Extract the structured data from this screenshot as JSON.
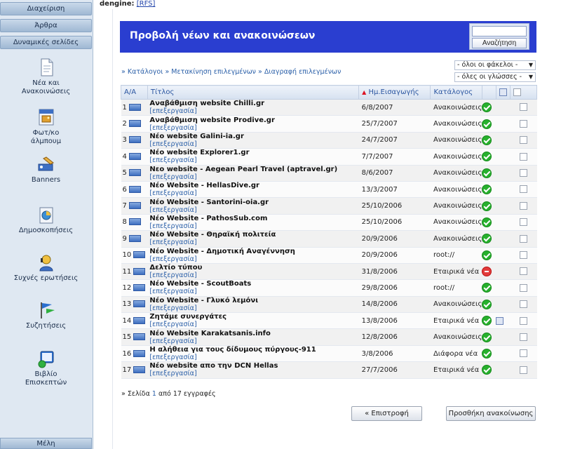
{
  "topline": {
    "label": "dengine:",
    "link": "[RFS]"
  },
  "sidebar": {
    "tabs": [
      "Διαχείριση",
      "Άρθρα",
      "Δυναμικές σελίδες"
    ],
    "items": [
      {
        "label1": "Νέα και",
        "label2": "Ανακοινώσεις",
        "icon": "news-document-icon"
      },
      {
        "label1": "Φωτ/κο",
        "label2": "άλμπουμ",
        "icon": "photo-album-icon"
      },
      {
        "label1": "Banners",
        "label2": "",
        "icon": "banners-icon"
      },
      {
        "label1": "Δημοσκοπήσεις",
        "label2": "",
        "icon": "polls-icon"
      },
      {
        "label1": "Συχνές ερωτήσεις",
        "label2": "",
        "icon": "faq-icon"
      },
      {
        "label1": "Συζητήσεις",
        "label2": "",
        "icon": "discussions-icon"
      },
      {
        "label1": "Βιβλίο",
        "label2": "Επισκεπτών",
        "icon": "guestbook-icon"
      }
    ],
    "bottom": "Μέλη"
  },
  "header": {
    "title": "Προβολή νέων και ανακοινώσεων",
    "search_button": "Αναζήτηση",
    "search_value": ""
  },
  "breadcrumb": {
    "items": [
      "Κατάλογοι",
      "Μετακίνηση επιλεγμένων",
      "Διαγραφή επιλεγμένων"
    ],
    "sep": "»"
  },
  "filters": {
    "folders": "- όλοι οι φάκελοι -",
    "languages": "- όλες οι γλώσσες -"
  },
  "table": {
    "headers": {
      "num": "Α/Α",
      "title": "Τίτλος",
      "date": "Ημ.Εισαγωγής",
      "category": "Κατάλογος"
    },
    "edit_label": "[επεξεργασία]",
    "rows": [
      {
        "n": "1",
        "title": "Αναβάθμιση website Chilli.gr",
        "date": "6/8/2007",
        "cat": "Ανακοινώσεις",
        "status": "ok"
      },
      {
        "n": "2",
        "title": "Αναβάθμιση website Prodive.gr",
        "date": "25/7/2007",
        "cat": "Ανακοινώσεις",
        "status": "ok"
      },
      {
        "n": "3",
        "title": "Νέο website Galini-ia.gr",
        "date": "24/7/2007",
        "cat": "Ανακοινώσεις",
        "status": "ok"
      },
      {
        "n": "4",
        "title": "Νέο website Explorer1.gr",
        "date": "7/7/2007",
        "cat": "Ανακοινώσεις",
        "status": "ok"
      },
      {
        "n": "5",
        "title": "Νεο website - Aegean Pearl Travel (aptravel.gr)",
        "date": "8/6/2007",
        "cat": "Ανακοινώσεις",
        "status": "ok"
      },
      {
        "n": "6",
        "title": "Νέο Website - HellasDive.gr",
        "date": "13/3/2007",
        "cat": "Ανακοινώσεις",
        "status": "ok"
      },
      {
        "n": "7",
        "title": "Νέο Website - Santorini-oia.gr",
        "date": "25/10/2006",
        "cat": "Ανακοινώσεις",
        "status": "ok"
      },
      {
        "n": "8",
        "title": "Νέο Website - PathosSub.com",
        "date": "25/10/2006",
        "cat": "Ανακοινώσεις",
        "status": "ok"
      },
      {
        "n": "9",
        "title": "Νέο Website - Θηραϊκή πολιτεία",
        "date": "20/9/2006",
        "cat": "Ανακοινώσεις",
        "status": "ok"
      },
      {
        "n": "10",
        "title": "Νέο Website - Δημοτική Αναγέννηση",
        "date": "20/9/2006",
        "cat": "root://",
        "status": "ok"
      },
      {
        "n": "11",
        "title": "Δελτίο τύπου",
        "date": "31/8/2006",
        "cat": "Εταιρικά νέα",
        "status": "no"
      },
      {
        "n": "12",
        "title": "Νέο Website - ScoutBoats",
        "date": "29/8/2006",
        "cat": "root://",
        "status": "ok"
      },
      {
        "n": "13",
        "title": "Νέο Website - Γλυκό λεμόνι",
        "date": "14/8/2006",
        "cat": "Ανακοινώσεις",
        "status": "ok"
      },
      {
        "n": "14",
        "title": "Ζητάμε συνεργάτες",
        "date": "13/8/2006",
        "cat": "Εταιρικά νέα",
        "status": "ok",
        "extra": true
      },
      {
        "n": "15",
        "title": "Νέο Website Karakatsanis.info",
        "date": "12/8/2006",
        "cat": "Ανακοινώσεις",
        "status": "ok"
      },
      {
        "n": "16",
        "title": "Η αλήθεια για τους δίδυμους πύργους-911",
        "date": "3/8/2006",
        "cat": "Διάφορα νέα",
        "status": "ok"
      },
      {
        "n": "17",
        "title": "Νέο website απο την DCN Hellas",
        "date": "27/7/2006",
        "cat": "Εταιρικά νέα",
        "status": "ok"
      }
    ]
  },
  "pager": {
    "prefix": "» Σελίδα",
    "page": "1",
    "suffix": "από 17 εγγραφές"
  },
  "buttons": {
    "back": "« Επιστροφή",
    "add": "Προσθήκη ανακοίνωσης"
  }
}
